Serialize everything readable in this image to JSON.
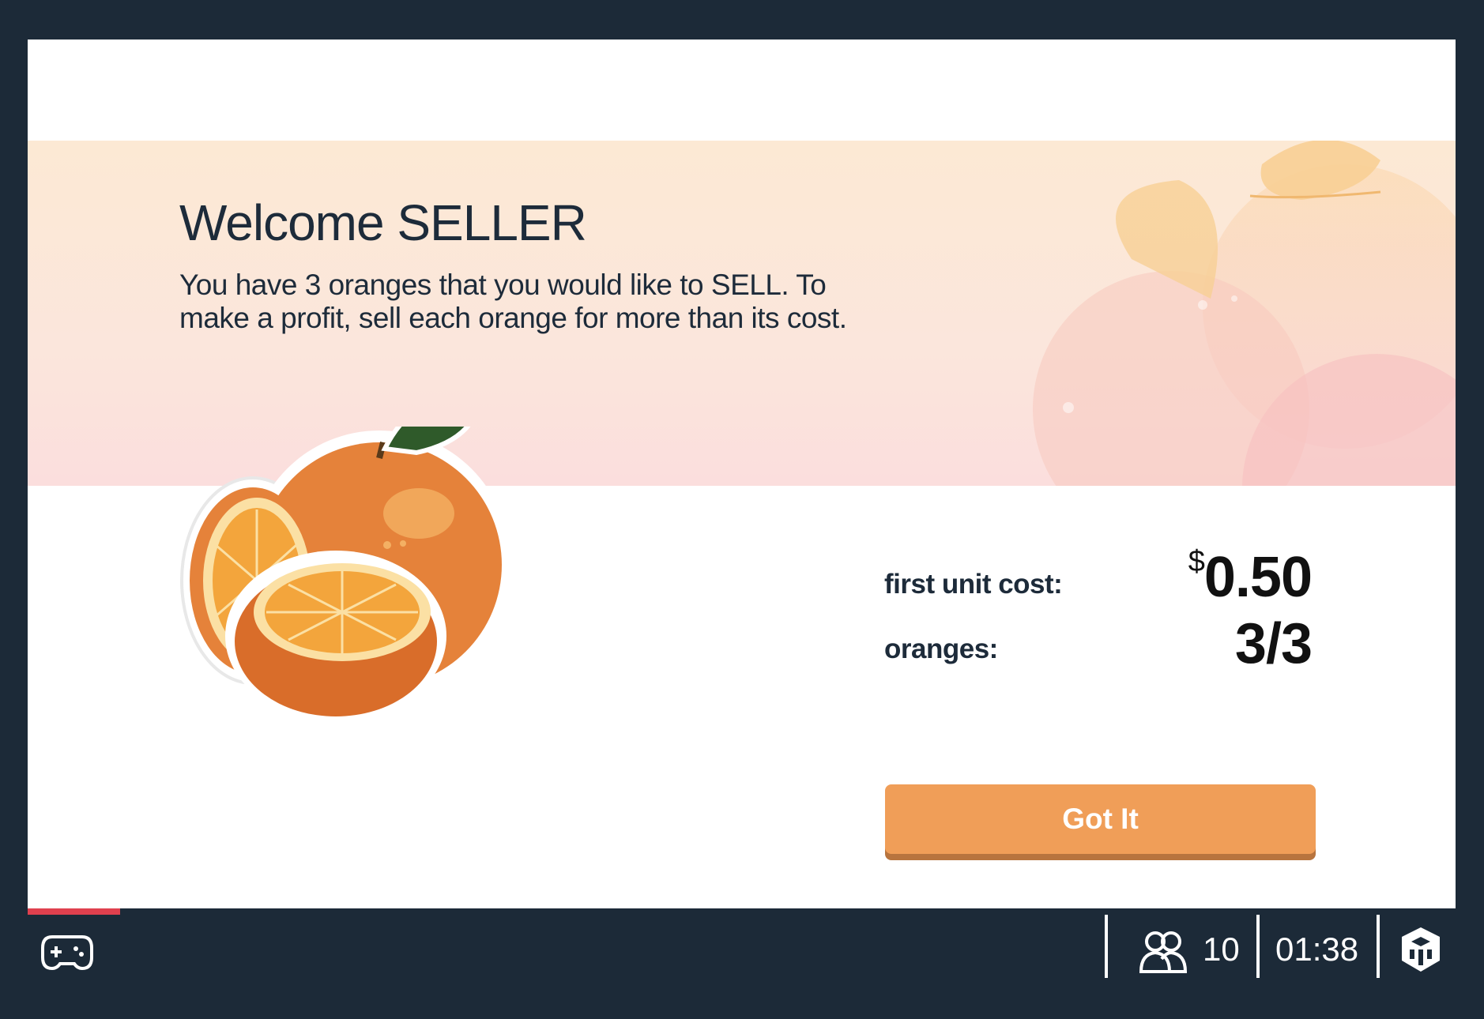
{
  "dialog": {
    "title": "Welcome SELLER",
    "description": "You have 3 oranges that you would like to SELL. To make a profit, sell each orange for more than its cost.",
    "stats": [
      {
        "label": "first unit cost:",
        "currency": "$",
        "value": "0.50"
      },
      {
        "label": "oranges:",
        "value": "3/3"
      }
    ],
    "button_label": "Got It"
  },
  "footer": {
    "players_count": "10",
    "timer": "01:38",
    "progress_fraction": 0.065,
    "icons": [
      "gamepad-icon",
      "players-icon",
      "logo-icon"
    ]
  },
  "colors": {
    "background": "#1c2a38",
    "accent": "#f09e58",
    "progress": "#e0404e",
    "text": "#1d2b3a"
  }
}
